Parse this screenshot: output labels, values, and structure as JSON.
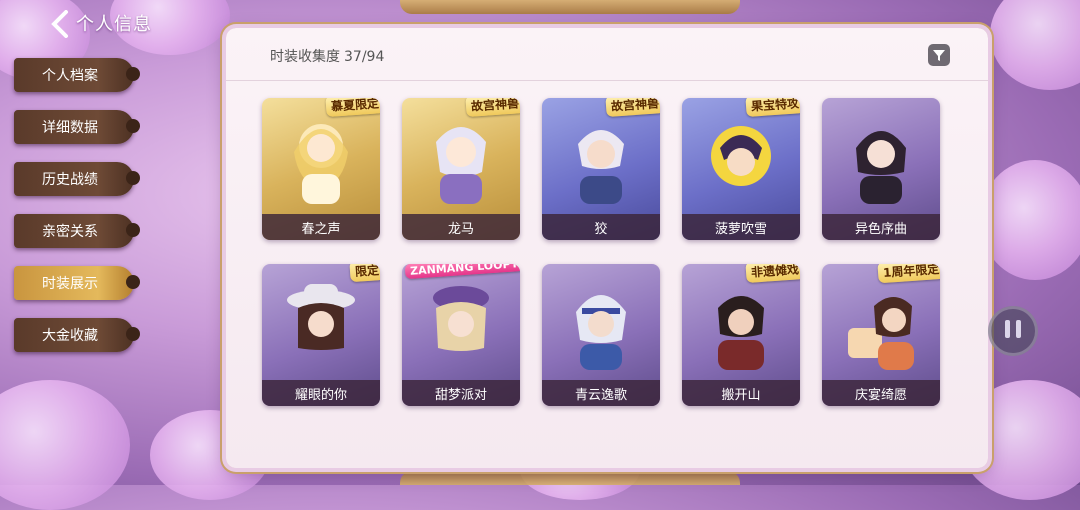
{
  "header": {
    "back_icon": "chevron-left-icon",
    "title": "个人信息"
  },
  "nav": {
    "items": [
      {
        "label": "个人档案",
        "active": false
      },
      {
        "label": "详细数据",
        "active": false
      },
      {
        "label": "历史战绩",
        "active": false
      },
      {
        "label": "亲密关系",
        "active": false
      },
      {
        "label": "时装展示",
        "active": true
      },
      {
        "label": "大金收藏",
        "active": false
      }
    ]
  },
  "collection": {
    "label": "时装收集度",
    "progress": "37/94",
    "filter_icon": "filter-icon"
  },
  "skins": [
    {
      "name": "春之声",
      "badge": "慕夏限定",
      "theme": "gold"
    },
    {
      "name": "龙马",
      "badge": "故宫神兽",
      "theme": "gold"
    },
    {
      "name": "狡",
      "badge": "故宫神兽",
      "theme": "blue"
    },
    {
      "name": "菠萝吹雪",
      "badge": "果宝特攻",
      "theme": "blue"
    },
    {
      "name": "异色序曲",
      "badge": "",
      "theme": "purple"
    },
    {
      "name": "耀眼的你",
      "badge": "限定",
      "theme": "purple"
    },
    {
      "name": "甜梦派对",
      "badge": "ZANMANG LOOPY",
      "theme": "purple"
    },
    {
      "name": "青云逸歌",
      "badge": "",
      "theme": "purple"
    },
    {
      "name": "搬开山",
      "badge": "非遗傩戏",
      "theme": "purple"
    },
    {
      "name": "庆宴绮愿",
      "badge": "1周年限定",
      "theme": "purple"
    }
  ],
  "colors": {
    "accent_gold": "#e4b95c",
    "nav_brown": "#6e4a36",
    "panel_bg": "#fbf3f7"
  },
  "controls": {
    "pause_icon": "pause-icon"
  }
}
